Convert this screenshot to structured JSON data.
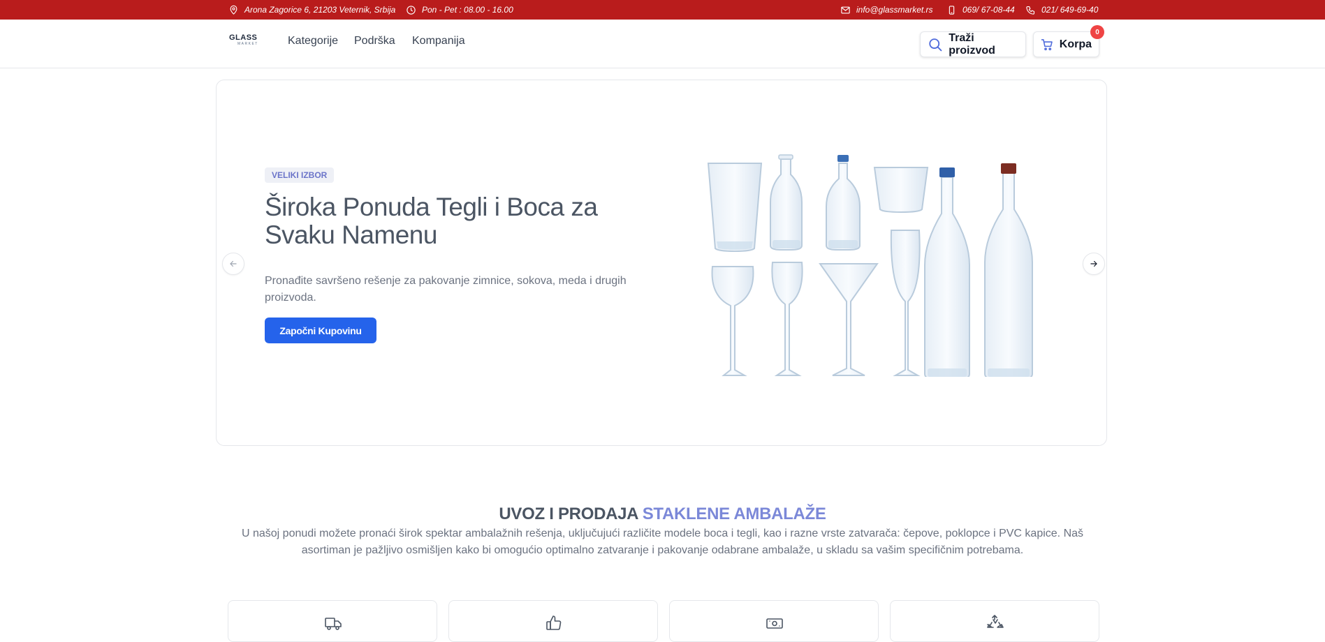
{
  "topbar": {
    "address": "Arona Zagorice 6, 21203 Veternik, Srbija",
    "hours": "Pon - Pet : 08.00 - 16.00",
    "email": "info@glassmarket.rs",
    "mobile": "069/ 67-08-44",
    "phone": "021/ 649-69-40",
    "icons": [
      "map-pin-icon",
      "clock-icon",
      "mail-icon",
      "mobile-icon",
      "phone-icon"
    ]
  },
  "header": {
    "logo_text": "GLASS",
    "logo_sub": "MARKET",
    "nav": [
      "Kategorije",
      "Podrška",
      "Kompanija"
    ],
    "search_label": "Traži proizvod",
    "cart_label": "Korpa",
    "cart_count": "0"
  },
  "hero": {
    "tag": "VELIKI IZBOR",
    "title": "Široka Ponuda Tegli i Boca za Svaku Namenu",
    "text": "Pronađite savršeno rešenje za pakovanje zimnice, sokova, meda i drugih proizvoda.",
    "cta": "Započni Kupovinu"
  },
  "intro": {
    "title_main": "UVOZ I PRODAJA",
    "title_accent": "STAKLENE AMBALAŽE",
    "text": "U našoj ponudi možete pronaći širok spektar ambalažnih rešenja, uključujući različite modele boca i tegli, kao i razne vrste zatvarača: čepove, poklopce i PVC kapice. Naš asortiman je pažljivo osmišljen kako bi omogućio optimalno zatvaranje i pakovanje odabrane ambalaže, u skladu sa vašim specifičnim potrebama."
  },
  "features": [
    "truck-icon",
    "thumbs-up-icon",
    "money-icon",
    "recycle-icon"
  ],
  "colors": {
    "topbar": "#b91c1c",
    "primary": "#2563eb",
    "accent": "#7b88d8",
    "badge": "#ef4444"
  }
}
